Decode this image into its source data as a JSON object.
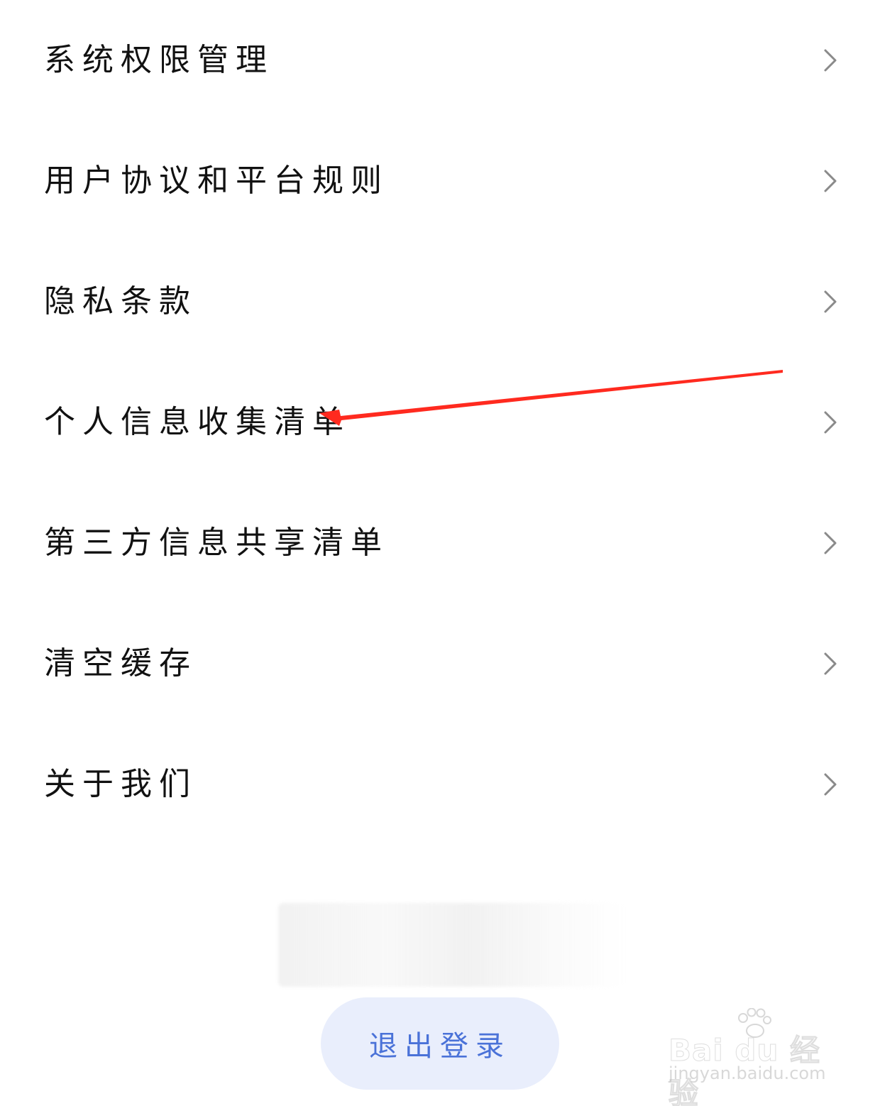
{
  "menu": {
    "items": [
      {
        "label": "系统权限管理",
        "icon": "chevron-right-icon"
      },
      {
        "label": "用户协议和平台规则",
        "icon": "chevron-right-icon"
      },
      {
        "label": "隐私条款",
        "icon": "chevron-right-icon"
      },
      {
        "label": "个人信息收集清单",
        "icon": "chevron-right-icon"
      },
      {
        "label": "第三方信息共享清单",
        "icon": "chevron-right-icon"
      },
      {
        "label": "清空缓存",
        "icon": "chevron-right-icon"
      },
      {
        "label": "关于我们",
        "icon": "chevron-right-icon"
      }
    ]
  },
  "annotation": {
    "type": "arrow",
    "color": "#ff2a1f",
    "points_to": "个人信息收集清单"
  },
  "logout": {
    "label": "退出登录",
    "text_color": "#4a72d8",
    "background": "#e9eefc"
  },
  "watermark": {
    "brand": "Bai du 经验",
    "url": "jingyan.baidu.com"
  },
  "colors": {
    "chevron": "#8a8a8a",
    "text": "#111111"
  }
}
